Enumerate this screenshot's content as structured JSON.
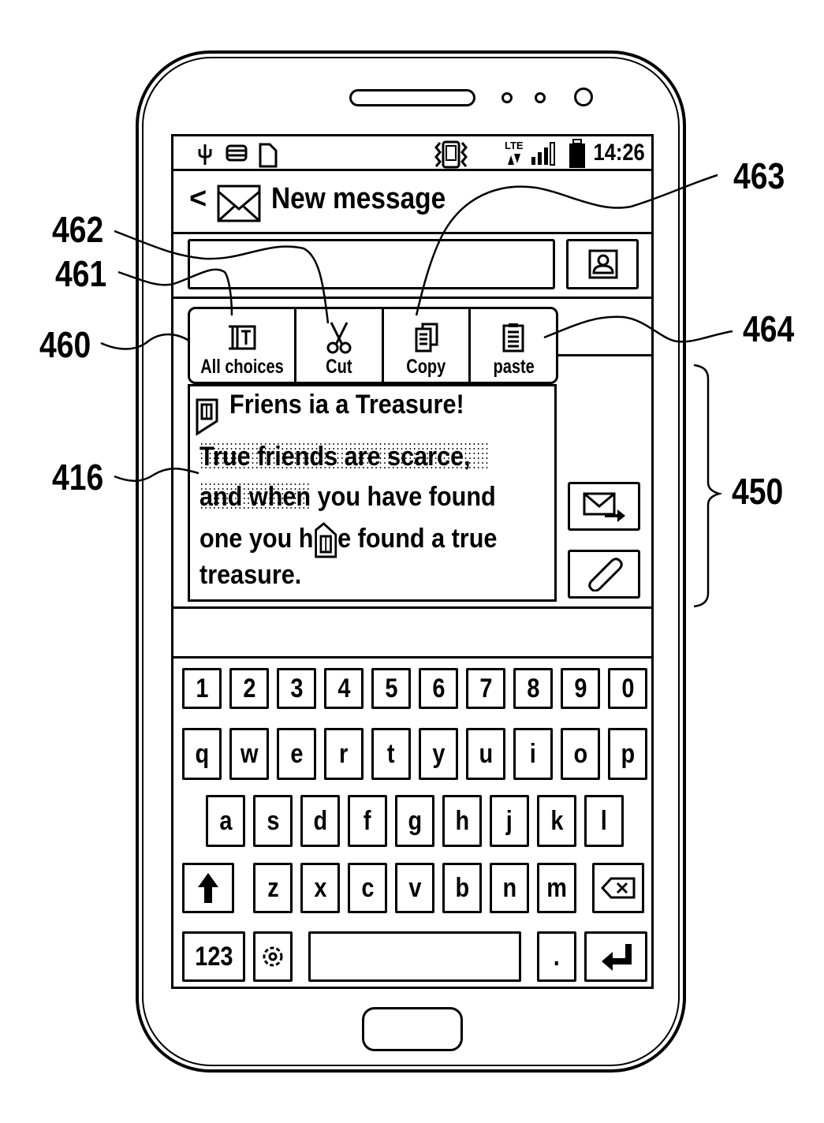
{
  "figure": {
    "reference_numerals": {
      "popup": "460",
      "select_all": "461",
      "cut": "462",
      "copy": "463",
      "paste": "464",
      "selected_text": "416",
      "compose_region": "450"
    }
  },
  "status_bar": {
    "left_icons": [
      "usb-icon",
      "storage-icon",
      "sd-card-icon"
    ],
    "center_icon": "vibrate-icon",
    "network": "LTE",
    "signal_icon": "signal-bars-icon",
    "battery_icon": "battery-icon",
    "time": "14:26"
  },
  "header": {
    "back_icon": "back-chevron-icon",
    "app_icon": "envelope-icon",
    "title": "New message"
  },
  "recipient": {
    "value": "",
    "contact_icon": "contact-icon"
  },
  "context_menu": {
    "items": [
      {
        "label": "All choices",
        "icon": "select-all-icon"
      },
      {
        "label": "Cut",
        "icon": "scissors-icon"
      },
      {
        "label": "Copy",
        "icon": "copy-icon"
      },
      {
        "label": "paste",
        "icon": "paste-icon"
      }
    ]
  },
  "editor": {
    "title": "Friens ia a Treasure!",
    "lines": [
      {
        "selected": "True friends are scarce,",
        "rest": ""
      },
      {
        "selected": "and when",
        "rest": " you have found"
      },
      {
        "before": "one you h",
        "after": "e found a true"
      },
      {
        "text": "treasure."
      }
    ]
  },
  "side_buttons": {
    "send_icon": "send-message-icon",
    "attach_icon": "paperclip-icon"
  },
  "keyboard": {
    "row_numbers": [
      "1",
      "2",
      "3",
      "4",
      "5",
      "6",
      "7",
      "8",
      "9",
      "0"
    ],
    "row_1": [
      "q",
      "w",
      "e",
      "r",
      "t",
      "y",
      "u",
      "i",
      "o",
      "p"
    ],
    "row_2": [
      "a",
      "s",
      "d",
      "f",
      "g",
      "h",
      "j",
      "k",
      "l"
    ],
    "row_3": [
      "z",
      "x",
      "c",
      "v",
      "b",
      "n",
      "m"
    ],
    "mode_key": "123",
    "period_key": "."
  }
}
